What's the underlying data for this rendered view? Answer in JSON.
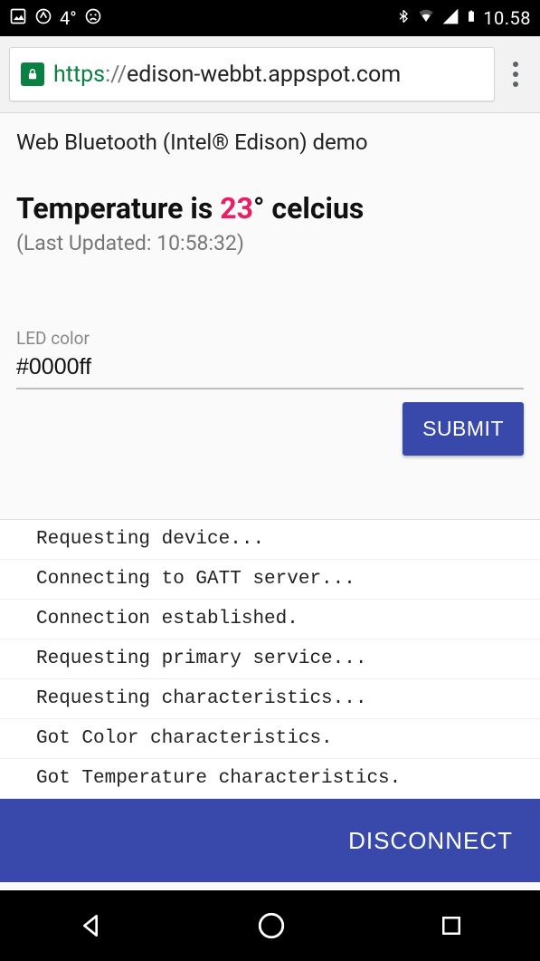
{
  "status_bar": {
    "temperature": "4°",
    "clock": "10.58"
  },
  "chrome": {
    "scheme": "https",
    "sep": "://",
    "host": "edison-webbt.appspot.com"
  },
  "page": {
    "demo_title": "Web Bluetooth (Intel® Edison) demo",
    "temp_prefix": "Temperature is ",
    "temp_value": "23",
    "temp_suffix": "° celcius",
    "updated": "(Last Updated: 10:58:32)",
    "led_label": "LED color",
    "led_value": "#0000ff",
    "submit_label": "SUBMIT",
    "log": [
      "Requesting device...",
      "Connecting to GATT server...",
      "Connection established.",
      "Requesting primary service...",
      "Requesting characteristics...",
      "Got Color characteristics.",
      "Got Temperature characteristics."
    ],
    "disconnect_label": "DISCONNECT"
  }
}
